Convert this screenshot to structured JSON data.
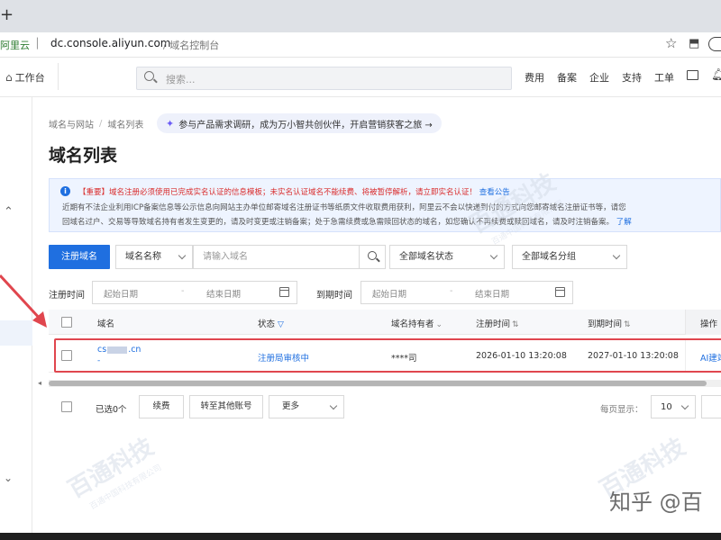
{
  "browser": {
    "new_tab": "+",
    "site_name": "阿里云",
    "url_domain": "dc.console.aliyun.com",
    "url_path": "/ 域名控制台"
  },
  "topnav": {
    "workbench": "工作台",
    "search_placeholder": "搜索...",
    "links": [
      "费用",
      "备案",
      "企业",
      "支持",
      "工单"
    ]
  },
  "breadcrumb": [
    "域名与网站",
    "域名列表"
  ],
  "promo": "参与产品需求调研，成为万小智共创伙伴，开启营销获客之旅 →",
  "page_title": "域名列表",
  "notice": {
    "line1_red": "【重要】域名注册必须使用已完成实名认证的信息模板；未实名认证域名不能续费、将被暂停解析，请立即实名认证！",
    "line1_link": "查看公告",
    "line2": "近期有不法企业利用ICP备案信息等公示信息向网站主办单位邮寄域名注册证书等纸质文件收取费用获利，阿里云不会以快递到付的方式向您邮寄域名注册证书等，请您",
    "line3": "回域名过户、交易等导致域名持有者发生变更的，请及时变更或注销备案；处于急需续费或急需赎回状态的域名，如您确认不再续费或赎回域名，请及时注销备案。",
    "line3_link": "了解"
  },
  "filters": {
    "register_button": "注册域名",
    "field_select": "域名名称",
    "search_placeholder": "请输入域名",
    "status_select": "全部域名状态",
    "group_select": "全部域名分组",
    "reg_time_label": "注册时间",
    "exp_time_label": "到期时间",
    "start_date": "起始日期",
    "end_date": "结束日期",
    "dash": "-"
  },
  "table": {
    "headers": {
      "domain": "域名",
      "status": "状态",
      "holder": "域名持有者",
      "reg_time": "注册时间",
      "exp_time": "到期时间",
      "actions": "操作"
    },
    "rows": [
      {
        "domain_prefix": "cs",
        "domain_suffix": ".cn",
        "domain_sub": "-",
        "status": "注册局审核中",
        "holder": "****司",
        "reg_time": "2026-01-10 13:20:08",
        "exp_time": "2027-01-10 13:20:08",
        "action": "AI建站"
      }
    ]
  },
  "footer": {
    "selected": "已选0个",
    "renew": "续费",
    "transfer": "转至其他账号",
    "more": "更多",
    "page_label": "每页显示：",
    "page_size": "10"
  },
  "watermarks": {
    "brand": "百通科技",
    "sub": "百通中国科技有限公司",
    "zhihu": "知乎 @百"
  },
  "colors": {
    "accent": "#1f6fe0",
    "highlight": "#e0464e",
    "alert": "#d92b2b"
  }
}
